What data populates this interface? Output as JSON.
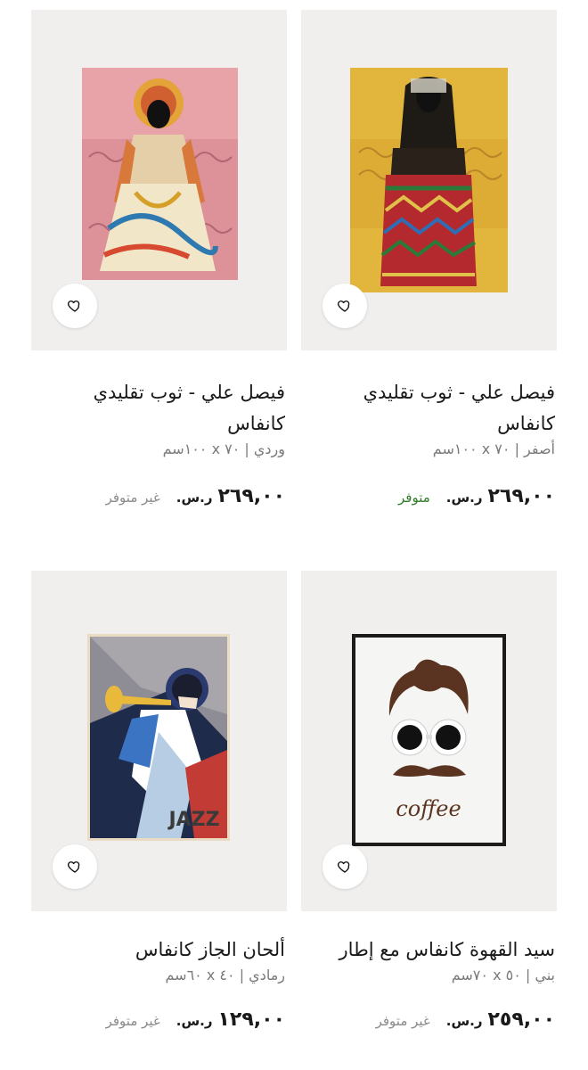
{
  "products": [
    {
      "title": "فيصل علي - ثوب تقليدي كانفاس",
      "variant": "أصفر | ٧٠ x ١٠٠سم",
      "price": "٢٦٩,٠٠",
      "currency": "ر.س.",
      "stock": "متوفر",
      "in_stock": true,
      "image": "yellow-traditional-dress-painting"
    },
    {
      "title": "فيصل علي - ثوب تقليدي كانفاس",
      "variant": "وردي | ٧٠ x ١٠٠سم",
      "price": "٢٦٩,٠٠",
      "currency": "ر.س.",
      "stock": "غير متوفر",
      "in_stock": false,
      "image": "pink-traditional-dress-painting"
    },
    {
      "title": "سيد القهوة كانفاس مع إطار",
      "variant": "بني | ٥٠ x ٧٠سم",
      "price": "٢٥٩,٠٠",
      "currency": "ر.س.",
      "stock": "غير متوفر",
      "in_stock": false,
      "image": "coffee-bean-face-framed-print"
    },
    {
      "title": "ألحان الجاز كانفاس",
      "variant": "رمادي | ٤٠ x ٦٠سم",
      "price": "١٢٩,٠٠",
      "currency": "ر.س.",
      "stock": "غير متوفر",
      "in_stock": false,
      "image": "jazz-trumpet-player-print"
    }
  ],
  "colors": {
    "card_bg": "#f0efee",
    "in_stock": "#2f7d2a",
    "out_of_stock": "#8a8a8a",
    "variant_text": "#7a7a7a"
  },
  "icons": {
    "wishlist": "heart-outline-icon"
  }
}
